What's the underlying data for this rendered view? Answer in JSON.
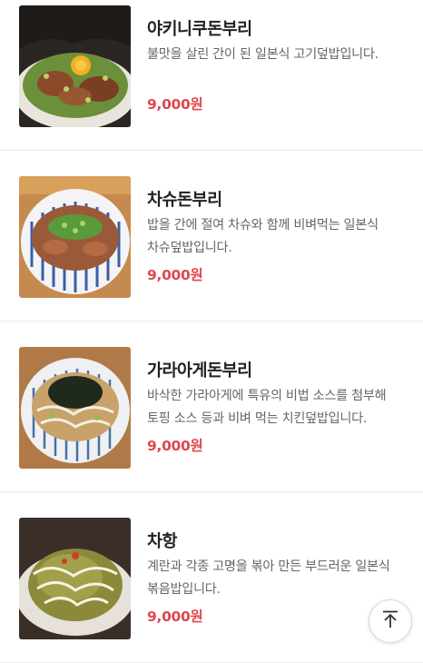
{
  "menu": {
    "items": [
      {
        "name": "야키니쿠돈부리",
        "description": "불맛을 살린 간이 된 일본식 고기덮밥입니다.",
        "price": "9,000원"
      },
      {
        "name": "차슈돈부리",
        "description": "밥을 간에 절여 차슈와 함께 비벼먹는 일본식 차슈덮밥입니다.",
        "price": "9,000원"
      },
      {
        "name": "가라아게돈부리",
        "description": "바삭한 가라아게에 특유의 비법 소스를 첨부해 토핑 소스 등과 비벼 먹는 치킨덮밥입니다.",
        "price": "9,000원"
      },
      {
        "name": "차항",
        "description": "계란과 각종 고명을 볶아 만든 부드러운 일본식 볶음밥입니다.",
        "price": "9,000원"
      }
    ]
  },
  "icons": {
    "scroll_top": "arrow-up-to-top-icon"
  },
  "colors": {
    "price": "#e0474c",
    "title": "#222222",
    "description": "#666666",
    "divider": "#ececec"
  }
}
